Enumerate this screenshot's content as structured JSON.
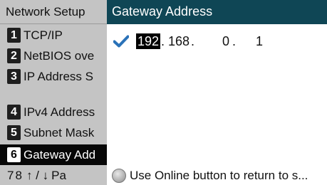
{
  "menu": {
    "title": "Network Setup",
    "items": [
      {
        "num": "1",
        "label": "TCP/IP"
      },
      {
        "num": "2",
        "label": "NetBIOS ove"
      },
      {
        "num": "3",
        "label": "IP Address S"
      },
      {
        "num": "4",
        "label": "IPv4 Address"
      },
      {
        "num": "5",
        "label": "Subnet Mask"
      },
      {
        "num": "6",
        "label": "Gateway Add",
        "selected": true
      }
    ],
    "footer": {
      "num_a": "7",
      "num_b": "8",
      "arrows": "↑ / ↓",
      "label": "Pa"
    }
  },
  "content": {
    "title": "Gateway Address",
    "ip": {
      "octet1": "192",
      "octet2": "168",
      "octet3": "0",
      "octet4": "1",
      "separator": "."
    },
    "status": "Use Online button to return to s..."
  },
  "colors": {
    "title_bar": "#0f4655",
    "selected_item": "#070707",
    "check": "#2a72b8"
  }
}
